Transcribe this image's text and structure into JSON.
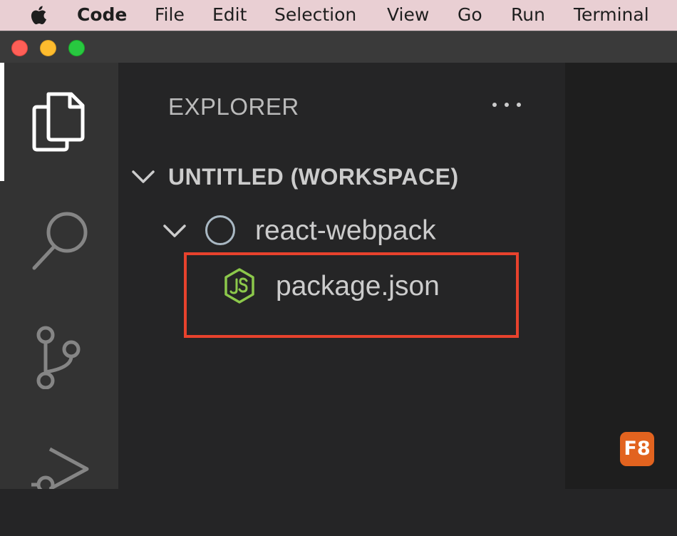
{
  "menubar": {
    "app_name": "Code",
    "items": [
      "File",
      "Edit",
      "Selection",
      "View",
      "Go",
      "Run",
      "Terminal"
    ]
  },
  "window": {
    "controls": [
      "close",
      "minimize",
      "maximize"
    ]
  },
  "activity_bar": {
    "items": [
      {
        "id": "explorer",
        "icon": "files-icon",
        "active": true
      },
      {
        "id": "search",
        "icon": "search-icon",
        "active": false
      },
      {
        "id": "source-control",
        "icon": "source-control-icon",
        "active": false
      },
      {
        "id": "run-debug",
        "icon": "run-debug-icon",
        "active": false
      }
    ]
  },
  "explorer": {
    "title": "EXPLORER",
    "more_actions_icon": "ellipsis-icon",
    "workspace": {
      "label": "UNTITLED (WORKSPACE)",
      "expanded": true,
      "folders": [
        {
          "label": "react-webpack",
          "icon": "folder-circle-icon",
          "expanded": true,
          "files": [
            {
              "label": "package.json",
              "icon": "nodejs-icon",
              "highlighted": true
            }
          ]
        }
      ]
    }
  },
  "badge": {
    "label": "F8",
    "color": "#e2631f"
  },
  "colors": {
    "highlight": "#e8422d",
    "nodejs_green": "#8cc84b",
    "activity_bar": "#333333",
    "sidebar": "#252526",
    "editor": "#1e1e1e",
    "menubar": "#e9cfd3"
  }
}
